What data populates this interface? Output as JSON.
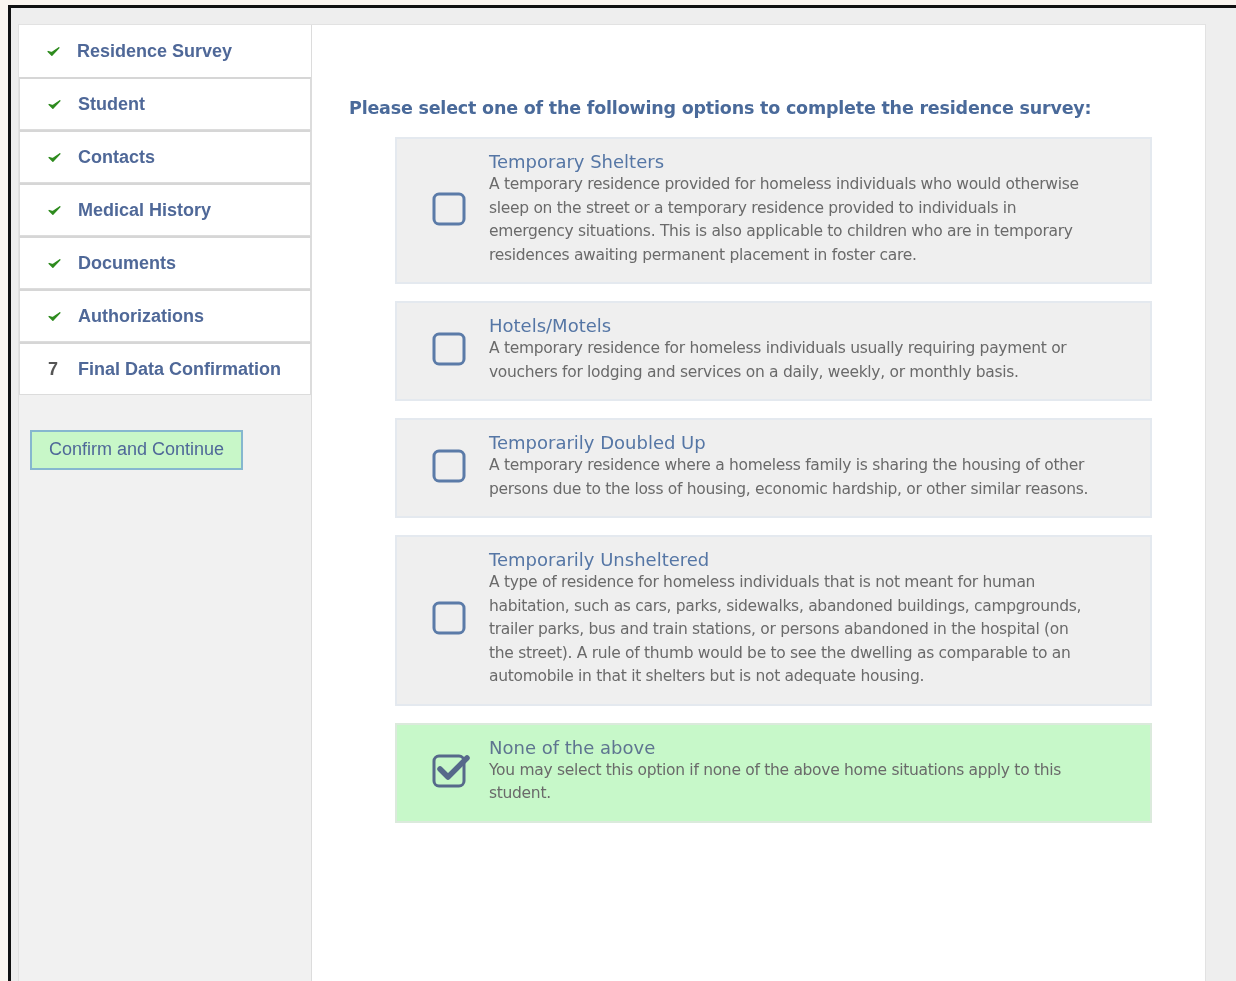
{
  "steps": [
    {
      "label": "Residence Survey",
      "completed": true,
      "selected": true
    },
    {
      "label": "Student",
      "completed": true,
      "selected": false
    },
    {
      "label": "Contacts",
      "completed": true,
      "selected": false
    },
    {
      "label": "Medical History",
      "completed": true,
      "selected": false
    },
    {
      "label": "Documents",
      "completed": true,
      "selected": false
    },
    {
      "label": "Authorizations",
      "completed": true,
      "selected": false
    },
    {
      "label": "Final Data Confirmation",
      "completed": false,
      "number": "7",
      "selected": false
    }
  ],
  "confirm_button": "Confirm and Continue",
  "prompt": "Please select one of the following options to complete the residence survey:",
  "options": [
    {
      "title": "Temporary Shelters",
      "description": "A temporary residence provided for homeless individuals who would otherwise sleep on the street or a temporary residence provided to individuals in emergency situations. This is also applicable to children who are in temporary residences awaiting permanent placement in foster care.",
      "checked": false
    },
    {
      "title": "Hotels/Motels",
      "description": "A temporary residence for homeless individuals usually requiring payment or vouchers for lodging and services on a daily, weekly, or monthly basis.",
      "checked": false
    },
    {
      "title": "Temporarily Doubled Up",
      "description": "A temporary residence where a homeless family is sharing the housing of other persons due to the loss of housing, economic hardship, or other similar reasons.",
      "checked": false
    },
    {
      "title": "Temporarily Unsheltered",
      "description": "A type of residence for homeless individuals that is not meant for human habitation, such as cars, parks, sidewalks, abandoned buildings, campgrounds, trailer parks, bus and train stations, or persons abandoned in the hospital (on the street). A rule of thumb would be to see the dwelling as comparable to an automobile in that it shelters but is not adequate housing.",
      "checked": false
    },
    {
      "title": "None of the above",
      "description": "You may select this option if none of the above home situations apply to this student.",
      "checked": true
    }
  ]
}
